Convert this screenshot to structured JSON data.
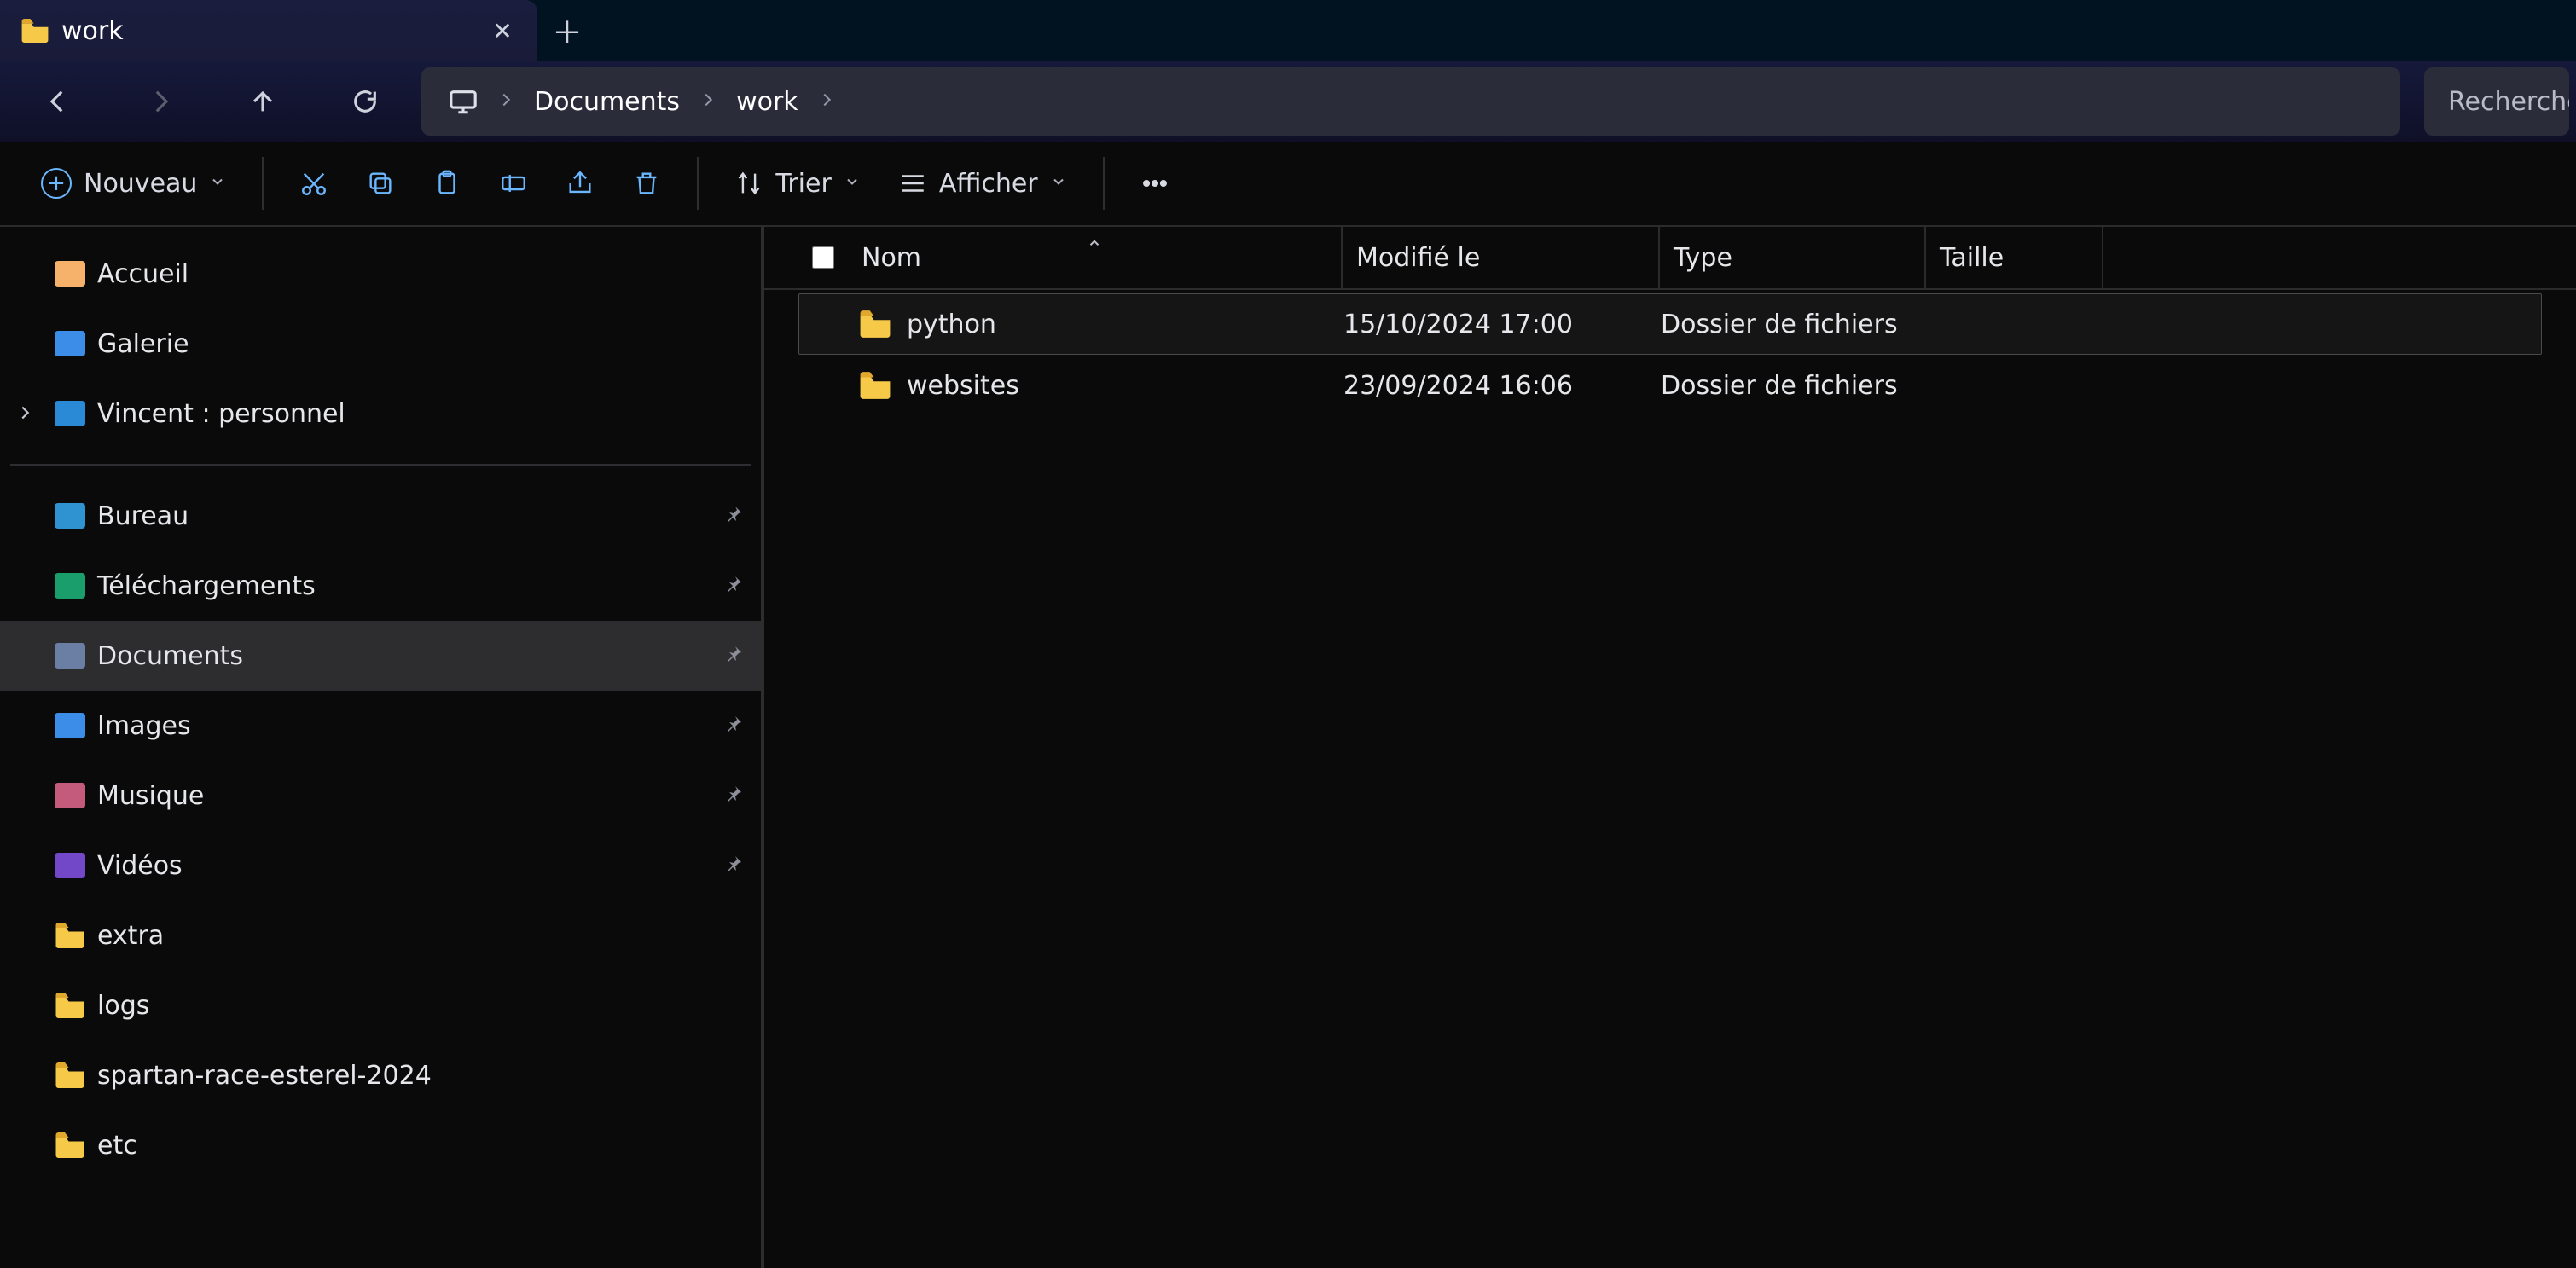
{
  "tab": {
    "title": "work"
  },
  "breadcrumb": {
    "segments": [
      {
        "kind": "pc-icon"
      },
      {
        "label": "Documents"
      },
      {
        "label": "work"
      }
    ]
  },
  "search": {
    "placeholder": "Recherche"
  },
  "toolbar": {
    "new_label": "Nouveau",
    "sort_label": "Trier",
    "view_label": "Afficher"
  },
  "sidebar": {
    "top": [
      {
        "name": "accueil",
        "label": "Accueil",
        "iconClass": "ic-home"
      },
      {
        "name": "galerie",
        "label": "Galerie",
        "iconClass": "ic-gal"
      },
      {
        "name": "onedrive",
        "label": "Vincent : personnel",
        "iconClass": "ic-od",
        "expandable": true
      }
    ],
    "quick": [
      {
        "name": "bureau",
        "label": "Bureau",
        "iconClass": "ic-desk",
        "pinned": true
      },
      {
        "name": "telechargements",
        "label": "Téléchargements",
        "iconClass": "ic-dl",
        "pinned": true
      },
      {
        "name": "documents",
        "label": "Documents",
        "iconClass": "ic-docs",
        "pinned": true,
        "active": true
      },
      {
        "name": "images",
        "label": "Images",
        "iconClass": "ic-img",
        "pinned": true
      },
      {
        "name": "musique",
        "label": "Musique",
        "iconClass": "ic-mus",
        "pinned": true
      },
      {
        "name": "videos",
        "label": "Vidéos",
        "iconClass": "ic-vid",
        "pinned": true
      },
      {
        "name": "extra",
        "label": "extra",
        "iconClass": "ic-fold"
      },
      {
        "name": "logs",
        "label": "logs",
        "iconClass": "ic-fold"
      },
      {
        "name": "spartan",
        "label": "spartan-race-esterel-2024",
        "iconClass": "ic-fold"
      },
      {
        "name": "etc",
        "label": "etc",
        "iconClass": "ic-fold"
      }
    ]
  },
  "columns": {
    "name": "Nom",
    "mod": "Modifié le",
    "type": "Type",
    "size": "Taille"
  },
  "rows": [
    {
      "name": "python",
      "modified": "15/10/2024 17:00",
      "type": "Dossier de fichiers",
      "size": "",
      "selected": true
    },
    {
      "name": "websites",
      "modified": "23/09/2024 16:06",
      "type": "Dossier de fichiers",
      "size": ""
    }
  ]
}
